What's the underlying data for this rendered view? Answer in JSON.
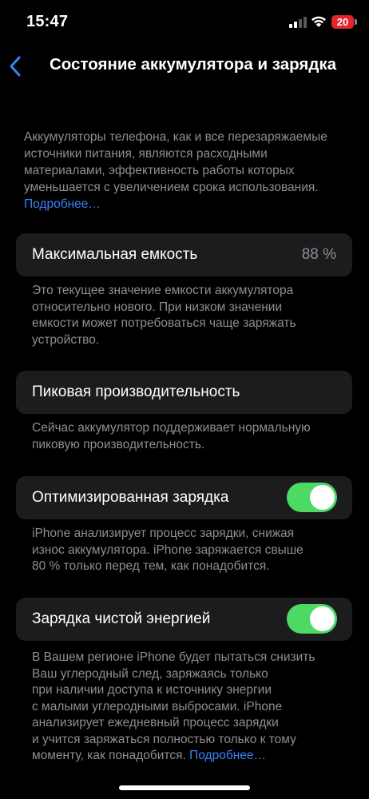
{
  "status_bar": {
    "time": "15:47",
    "battery_level": "20",
    "signal_icon": "cellular-signal-icon",
    "wifi_icon": "wifi-icon"
  },
  "nav": {
    "back_icon": "chevron-left-icon",
    "title": "Состояние аккумулятора и зарядка"
  },
  "intro": {
    "text": "Аккумуляторы телефона, как и все перезаряжаемые источники питания, являются расходными материалами, эффективность работы которых уменьшается с увеличением срока использования.",
    "link": "Подробнее…"
  },
  "max_capacity": {
    "label": "Максимальная емкость",
    "value": "88 %",
    "footer": [
      "Это текущее значение емкости аккумулятора",
      "относительно нового. При низком значении",
      "емкости может потребоваться чаще заряжать",
      "устройство."
    ]
  },
  "peak_performance": {
    "label": "Пиковая производительность",
    "footer": [
      "Сейчас аккумулятор поддерживает нормальную",
      "пиковую производительность."
    ]
  },
  "optimized_charging": {
    "label": "Оптимизированная зарядка",
    "enabled": true,
    "footer": [
      "iPhone анализирует процесс зарядки, снижая",
      "износ аккумулятора. iPhone заряжается свыше",
      "80 % только перед тем, как понадобится."
    ]
  },
  "clean_energy_charging": {
    "label": "Зарядка чистой энергией",
    "enabled": true,
    "footer": [
      "В Вашем регионе iPhone будет пытаться снизить",
      "Ваш углеродный след, заряжаясь только",
      "при наличии доступа к источнику энергии",
      "с малыми углеродными выбросами. iPhone",
      "анализирует ежедневный процесс зарядки",
      "и учится заряжаться полностью только к тому",
      "моменту, как понадобится."
    ],
    "link": "Подробнее…"
  },
  "colors": {
    "background": "#000000",
    "cell": "#1c1c1e",
    "secondary_text": "#8e8e93",
    "accent": "#3b82f6",
    "toggle_on": "#4cd964",
    "battery_low": "#e5242b"
  }
}
